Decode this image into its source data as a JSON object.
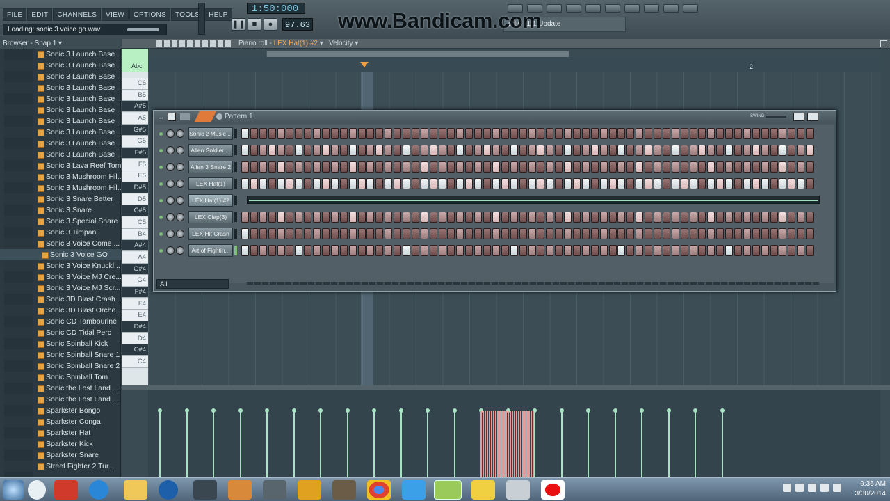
{
  "menu": [
    "FILE",
    "EDIT",
    "CHANNELS",
    "VIEW",
    "OPTIONS",
    "TOOLS",
    "HELP"
  ],
  "hint": "Loading: sonic 3 voice go.wav",
  "transport": {
    "time": "1:50:000",
    "tempo": "97.63"
  },
  "watermark": "www.Bandicam.com",
  "update": "udio 11.1 Update",
  "browser": {
    "title": "Browser - Snap 1",
    "items": [
      "Sonic 3 Launch Base ...",
      "Sonic 3 Launch Base ...",
      "Sonic 3 Launch Base ...",
      "Sonic 3 Launch Base ...",
      "Sonic 3 Launch Base ...",
      "Sonic 3 Launch Base ...",
      "Sonic 3 Launch Base ...",
      "Sonic 3 Launch Base ...",
      "Sonic 3 Launch Base ...",
      "Sonic 3 Launch Base ...",
      "Sonic 3 Lava Reef Tom",
      "Sonic 3 Mushroom Hil...",
      "Sonic 3 Mushroom Hil...",
      "Sonic 3 Snare Better",
      "Sonic 3 Snare",
      "Sonic 3 Special Snare",
      "Sonic 3 Timpani",
      "Sonic 3 Voice Come ...",
      "Sonic 3 Voice GO",
      "Sonic 3 Voice Knuckl...",
      "Sonic 3 Voice MJ Cre...",
      "Sonic 3 Voice MJ Scr...",
      "Sonic 3D Blast Crash ...",
      "Sonic 3D Blast Orche...",
      "Sonic CD Tambourine",
      "Sonic CD Tidal Perc",
      "Sonic Spinball Kick",
      "Sonic Spinball Snare 1",
      "Sonic Spinball Snare 2",
      "Sonic Spinball Tom",
      "Sonic the Lost Land ...",
      "Sonic the Lost Land ...",
      "Sparkster Bongo",
      "Sparkster Conga",
      "Sparkster Hat",
      "Sparkster Kick",
      "Sparkster Snare",
      "Street Fighter 2 Tur..."
    ],
    "selected_index": 18
  },
  "pianoroll": {
    "title_prefix": "Piano roll - ",
    "channel": "LEX Hat(1) #2",
    "param": "Velocity",
    "ruler_mark": "2",
    "keys": [
      "C6",
      "B5",
      "A#5",
      "A5",
      "G#5",
      "G5",
      "F#5",
      "F5",
      "E5",
      "D#5",
      "D5",
      "C#5",
      "C5",
      "B4",
      "A#4",
      "A4",
      "G#4",
      "G4",
      "F#4",
      "F4",
      "E4",
      "D#4",
      "D4",
      "C#4",
      "C4"
    ],
    "abc_label": "Abc"
  },
  "sequencer": {
    "title": "Pattern 1",
    "swing_label": "SWING",
    "filter": "All",
    "channels": [
      {
        "name": "Sonic 2 Music ...",
        "pattern": "0"
      },
      {
        "name": "Alien Soldier ...",
        "pattern": "a"
      },
      {
        "name": "Alien 3 Snare 2",
        "pattern": "b"
      },
      {
        "name": "LEX Hat(1)",
        "pattern": "c"
      },
      {
        "name": "LEX Hat(1) #2",
        "pattern": "piano"
      },
      {
        "name": "LEX Clap(3)",
        "pattern": "b"
      },
      {
        "name": "LEX Hit Crash",
        "pattern": "0"
      },
      {
        "name": "Art of Fightin...",
        "pattern": "d"
      }
    ]
  },
  "taskbar": {
    "time": "9:36 AM",
    "date": "3/30/2014"
  },
  "colors": {
    "accent": "#f0a040",
    "velocity": "#a7e3c3",
    "selected_velocity": "#e29b9b"
  }
}
